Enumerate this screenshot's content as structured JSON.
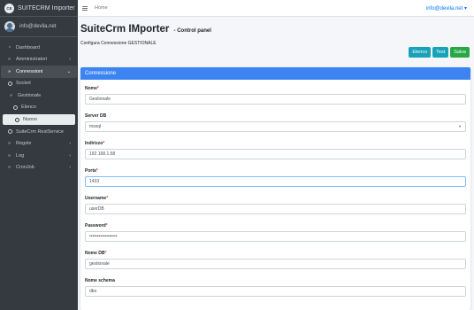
{
  "brand": {
    "logo_text": "CE",
    "name": "SUITECRM Importer"
  },
  "user": {
    "name": "info@devila.net"
  },
  "sidebar": {
    "items": [
      {
        "icon": "tachometer-icon",
        "glyph": "◔",
        "label": "Dashboard"
      },
      {
        "icon": "double-chevron-icon",
        "glyph": "»",
        "label": "Amministratori",
        "chevron": "‹"
      },
      {
        "icon": "double-chevron-icon",
        "glyph": "»",
        "label": "Connessioni",
        "chevron": "⌄"
      },
      {
        "label": "Socket"
      },
      {
        "label": "Gestionale"
      },
      {
        "label": "Elenco"
      },
      {
        "label": "Nuovo"
      },
      {
        "label": "SuiteCrm RestService"
      },
      {
        "icon": "double-chevron-icon",
        "glyph": "»",
        "label": "Regole",
        "chevron": "‹"
      },
      {
        "icon": "double-chevron-icon",
        "glyph": "»",
        "label": "Log",
        "chevron": "‹"
      },
      {
        "icon": "double-chevron-icon",
        "glyph": "»",
        "label": "CronJob",
        "chevron": "‹"
      }
    ]
  },
  "topbar": {
    "home": "Home",
    "user_menu": "info@devila.net ▾"
  },
  "page": {
    "title": "SuiteCrm IMporter",
    "subtitle": "- Control panel",
    "description": "Configura Connessione GESTIONALE"
  },
  "actions": {
    "list": "Elenco",
    "test": "Test",
    "save": "Salva"
  },
  "card": {
    "title": "Connessione"
  },
  "form": {
    "fields": [
      {
        "label": "Nome",
        "required": "*",
        "value": "Gestionale"
      },
      {
        "label": "Server DB",
        "required": "",
        "value": "mssql"
      },
      {
        "label": "Indirizzo",
        "required": "*",
        "value": "192.168.1.58"
      },
      {
        "label": "Porta",
        "required": "*",
        "value": "1433"
      },
      {
        "label": "Username",
        "required": "*",
        "value": "userDB"
      },
      {
        "label": "Password",
        "required": "*",
        "value": "••••••••••••••••••"
      },
      {
        "label": "Nome DB",
        "required": "*",
        "value": "gestionale"
      },
      {
        "label": "Nome schema",
        "required": "",
        "value": "dbo"
      }
    ]
  },
  "colors": {
    "sidebar": "#343a40",
    "card_header": "#3c84f1",
    "info": "#17a2b8",
    "success": "#28a745",
    "link": "#007bff"
  }
}
